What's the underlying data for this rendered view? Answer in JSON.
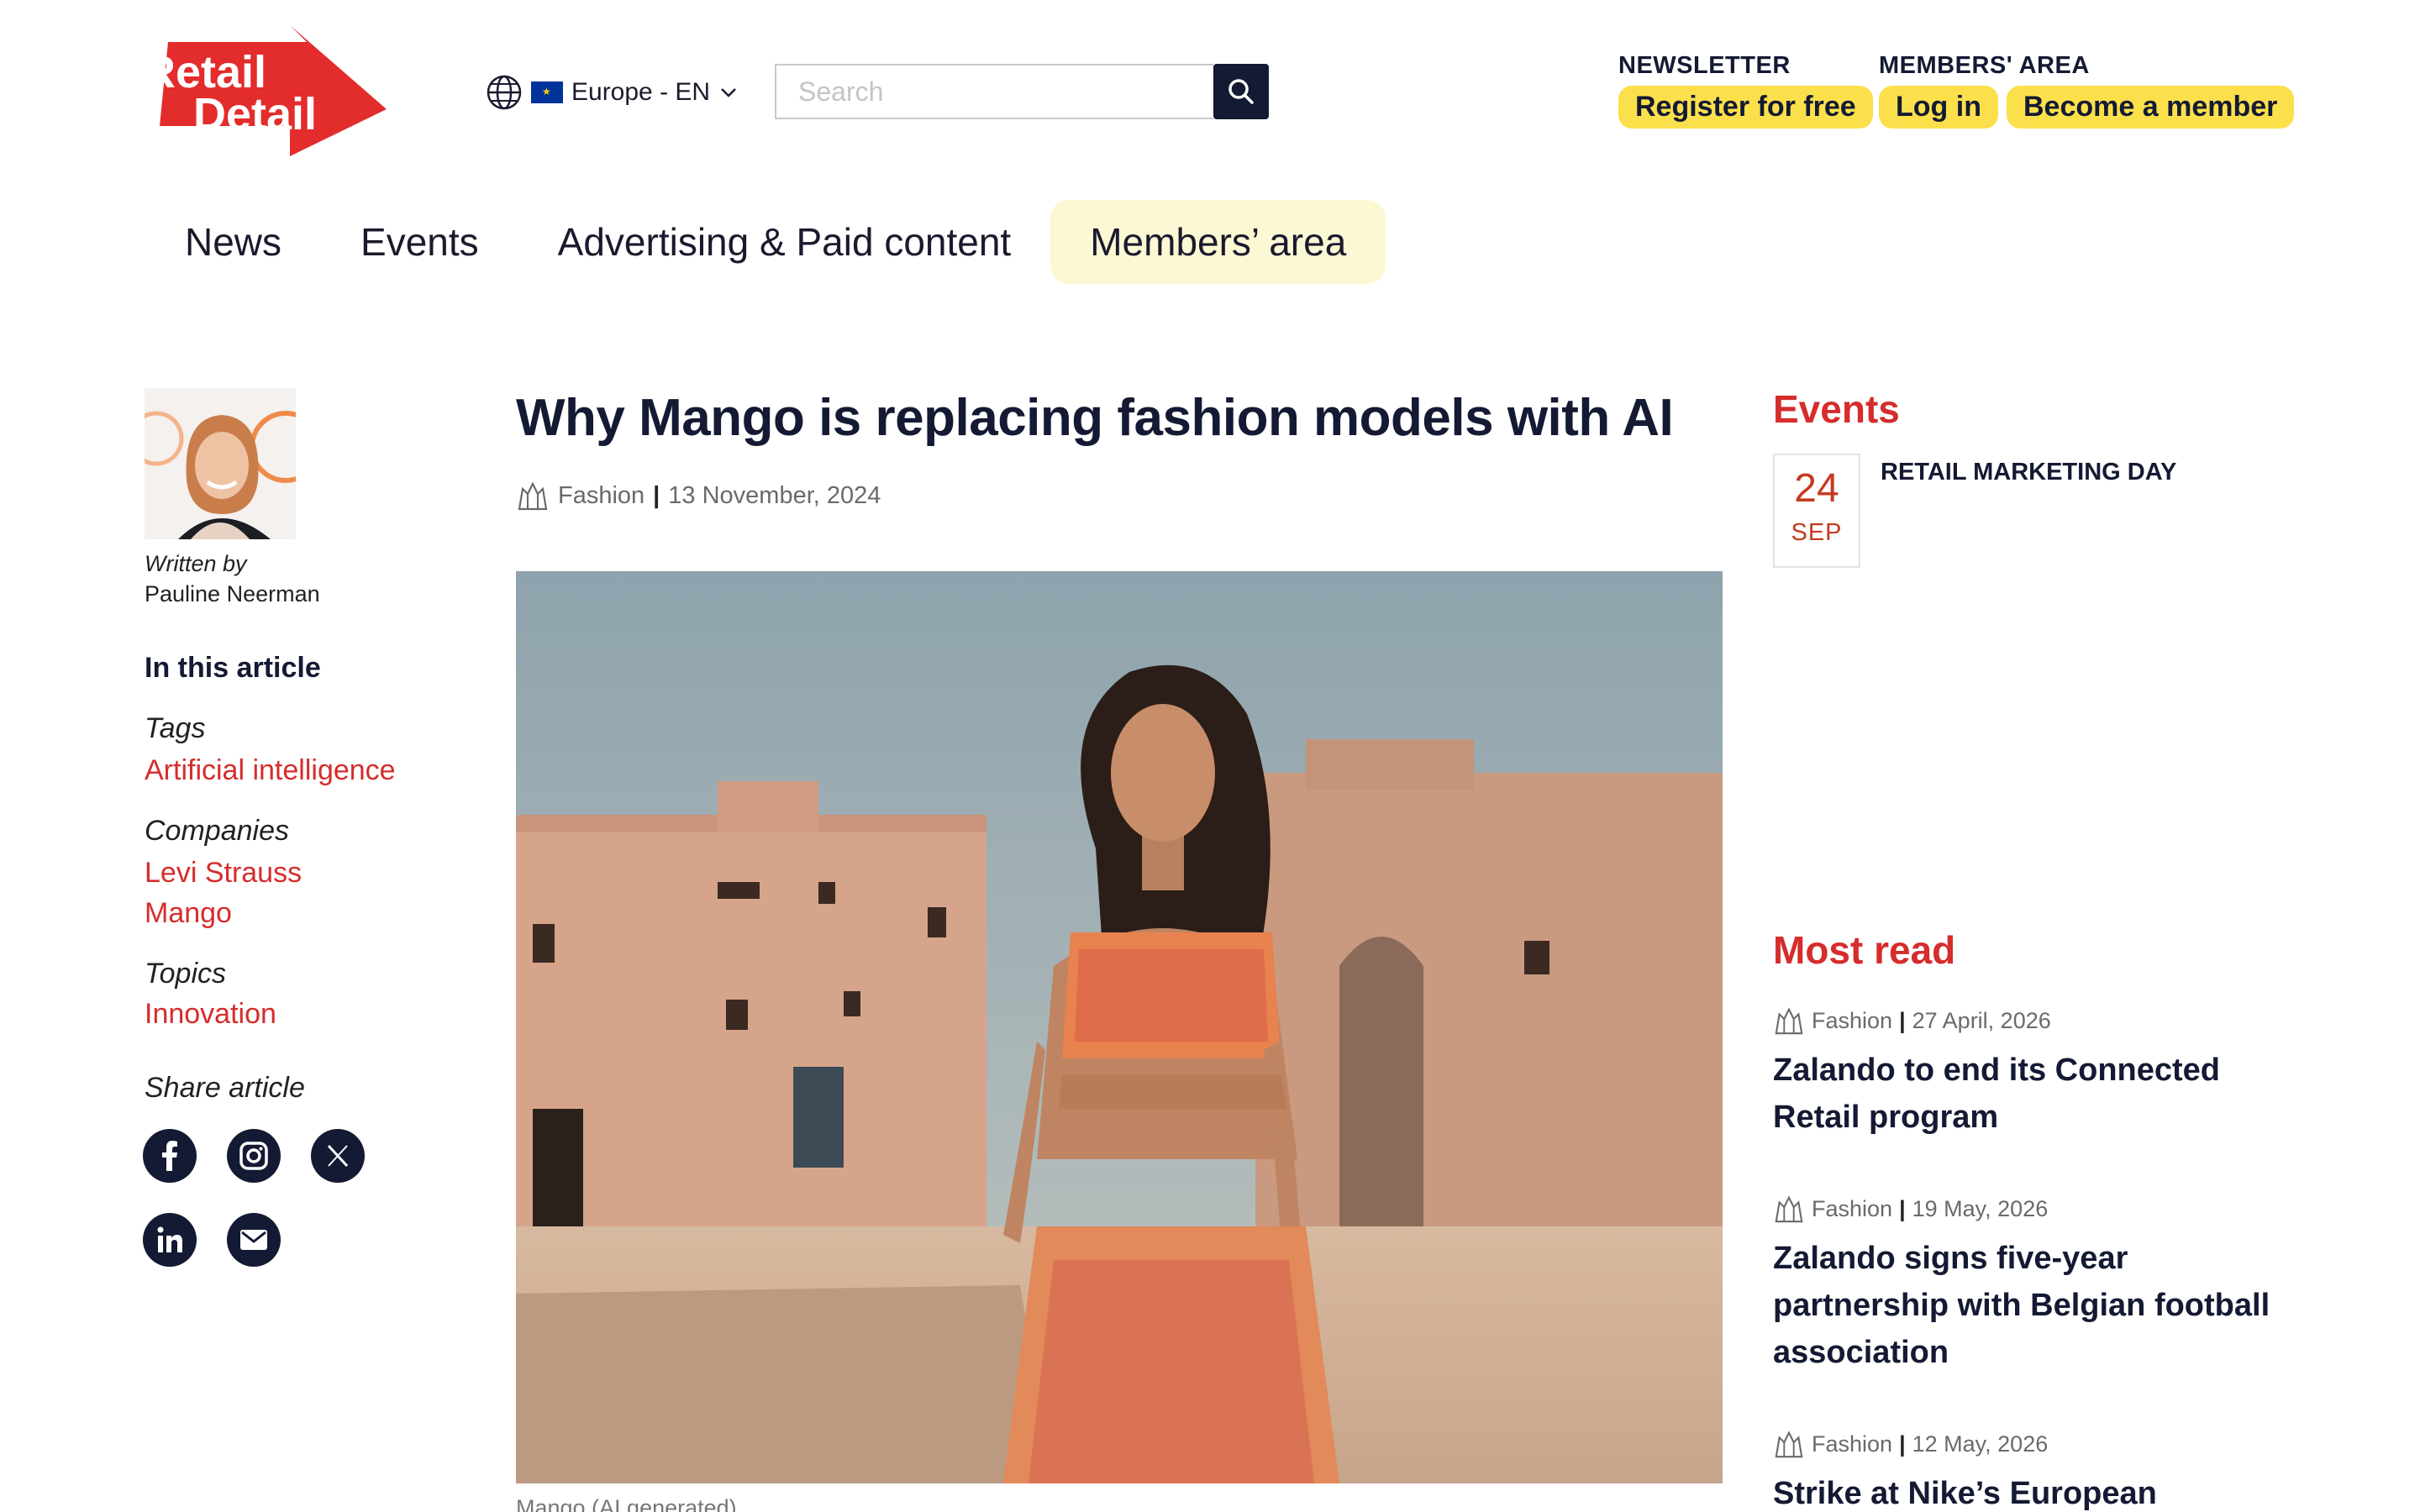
{
  "logo": {
    "line1": "Retail",
    "line2": "Detail"
  },
  "region": {
    "label": "Europe - EN"
  },
  "search": {
    "placeholder": "Search"
  },
  "header": {
    "newsletter_label": "NEWSLETTER",
    "members_label": "MEMBERS' AREA",
    "register_button": "Register for free",
    "login_button": "Log in",
    "become_button": "Become a member"
  },
  "nav": {
    "items": [
      {
        "label": "News"
      },
      {
        "label": "Events"
      },
      {
        "label": "Advertising & Paid content"
      },
      {
        "label": "Members’ area"
      }
    ],
    "active_index": 3
  },
  "author": {
    "written_by": "Written by",
    "name": "Pauline Neerman"
  },
  "sidebar": {
    "in_this_article": "In this article",
    "tags_label": "Tags",
    "tags": [
      "Artificial intelligence"
    ],
    "companies_label": "Companies",
    "companies": [
      "Levi Strauss",
      "Mango"
    ],
    "topics_label": "Topics",
    "topics": [
      "Innovation"
    ],
    "share_label": "Share article",
    "share_icons": [
      "facebook-icon",
      "instagram-icon",
      "x-icon",
      "linkedin-icon",
      "email-icon"
    ]
  },
  "article": {
    "title": "Why Mango is replacing fashion models with AI",
    "category": "Fashion",
    "date": "13 November, 2024",
    "caption": "Mango (AI generated)"
  },
  "events": {
    "heading": "Events",
    "items": [
      {
        "day": "24",
        "month": "SEP",
        "title": "RETAIL MARKETING DAY"
      }
    ]
  },
  "most_read": {
    "heading": "Most read",
    "items": [
      {
        "category": "Fashion",
        "date": "27 April, 2026",
        "title": "Zalando to end its Connected Retail program"
      },
      {
        "category": "Fashion",
        "date": "19 May, 2026",
        "title": "Zalando signs five-year partnership with Belgian football association"
      },
      {
        "category": "Fashion",
        "date": "12 May, 2026",
        "title": "Strike at Nike’s European"
      }
    ]
  },
  "colors": {
    "accent_red": "#d62c2c",
    "pill_yellow": "#fbe04b",
    "navy": "#141a33",
    "nav_active_bg": "#fdf8d4"
  }
}
